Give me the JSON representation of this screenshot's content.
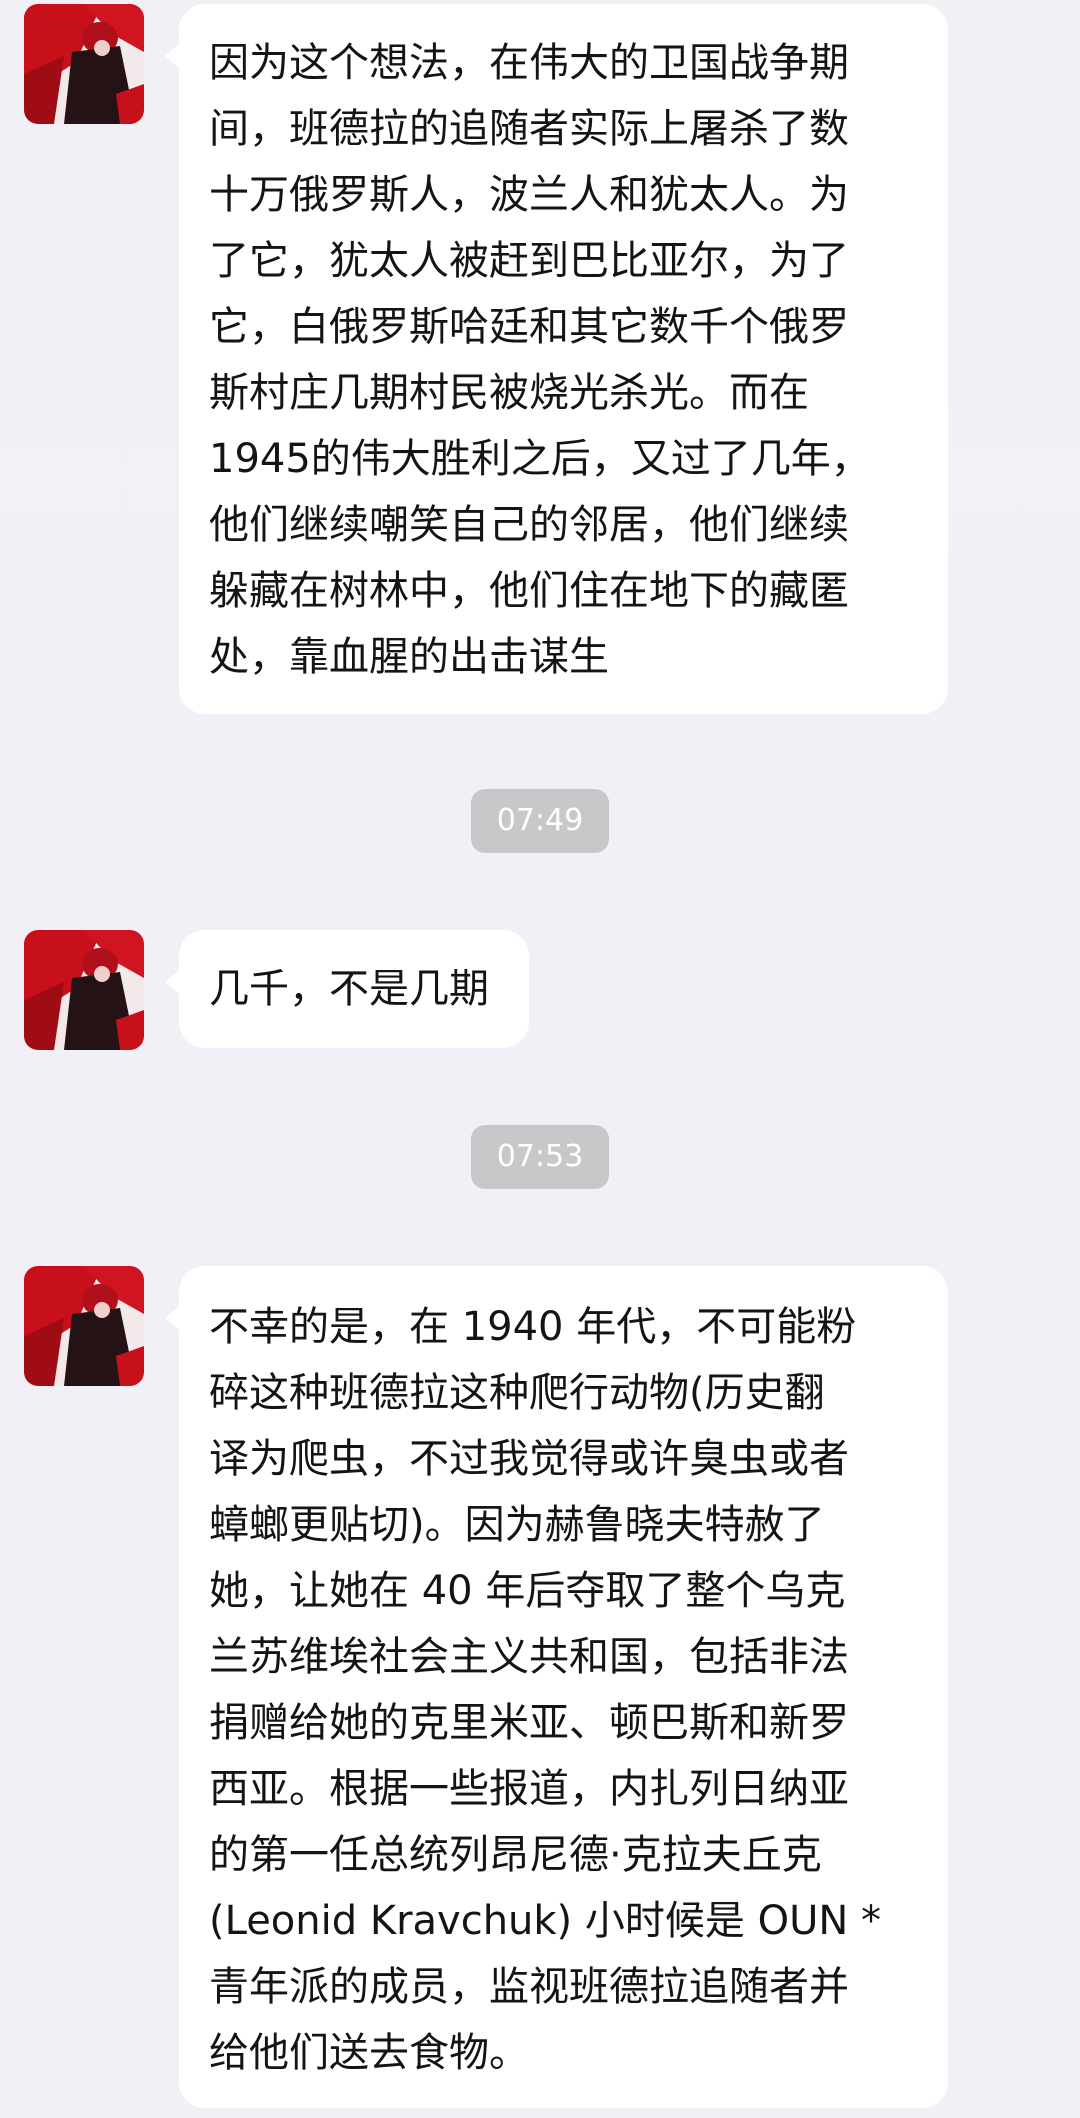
{
  "messages": [
    {
      "lines": [
        "因为这个想法，在伟大的卫国战争期",
        "间，班德拉的追随者实际上屠杀了数",
        "十万俄罗斯人，波兰人和犹太人。为",
        "了它，犹太人被赶到巴比亚尔，为了",
        "它，白俄罗斯哈廷和其它数千个俄罗",
        "斯村庄几期村民被烧光杀光。而在",
        "1945的伟大胜利之后，又过了几年，",
        "他们继续嘲笑自己的邻居，他们继续",
        "躲藏在树林中，他们住在地下的藏匿",
        "处，靠血腥的出击谋生"
      ]
    },
    {
      "lines": [
        "几千，不是几期"
      ]
    },
    {
      "lines": [
        "不幸的是，在 1940 年代，不可能粉",
        "碎这种班德拉这种爬行动物(历史翻",
        "译为爬虫，不过我觉得或许臭虫或者",
        "蟑螂更贴切)。因为赫鲁晓夫特赦了",
        "她，让她在 40 年后夺取了整个乌克",
        "兰苏维埃社会主义共和国，包括非法",
        "捐赠给她的克里米亚、顿巴斯和新罗",
        "西亚。根据一些报道，内扎列日纳亚",
        "的第一任总统列昂尼德·克拉夫丘克",
        "(Leonid Kravchuk) 小时候是 OUN *",
        "青年派的成员，监视班德拉追随者并",
        "给他们送去食物。"
      ]
    }
  ],
  "timestamps": [
    "07:49",
    "07:53"
  ],
  "avatar": {
    "icon": "user-avatar-icon",
    "colors": [
      "#c8101a",
      "#2a1416",
      "#f3e9ea"
    ]
  }
}
